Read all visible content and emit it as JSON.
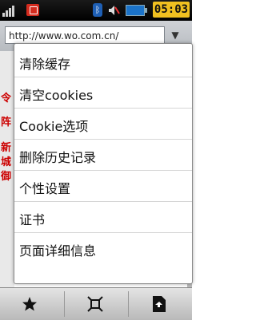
{
  "status_bar": {
    "time": "05:03",
    "bluetooth_icon": "bluetooth-icon"
  },
  "url_bar": {
    "url": "http://www.wo.com.cn/",
    "dropdown_icon": "▼"
  },
  "background_page": {
    "side_text": [
      "令",
      "阵",
      "新",
      "城",
      "御"
    ]
  },
  "menu": {
    "items": [
      {
        "label": "清除缓存"
      },
      {
        "label": "清空cookies"
      },
      {
        "label": "Cookie选项"
      },
      {
        "label": "删除历史记录"
      },
      {
        "label": "个性设置"
      },
      {
        "label": "证书"
      },
      {
        "label": "页面详细信息"
      }
    ]
  },
  "toolbar": {
    "buttons": [
      "star-icon",
      "fullscreen-icon",
      "page-icon"
    ]
  }
}
